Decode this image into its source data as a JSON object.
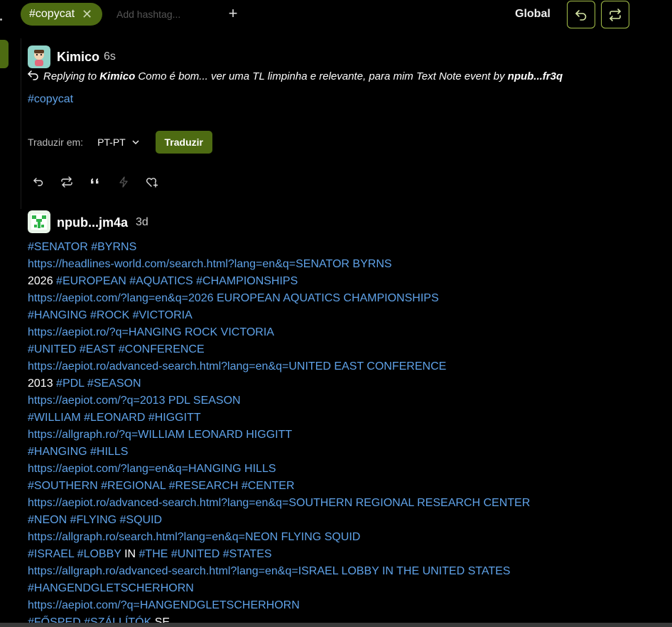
{
  "topbar": {
    "chip_label": "#copycat",
    "chip_close": "✕",
    "hashtag_placeholder": "Add hashtag...",
    "add_symbol": "+",
    "feed_label": "Global"
  },
  "note1": {
    "author": "Kimico",
    "time": "6s",
    "reply_prefix": "Replying to",
    "reply_author": "Kimico",
    "reply_text": "Como é bom... ver uma TL limpinha e relevante, para mim Text Note event by",
    "reply_npub": "npub...fr3q",
    "hashtag": "#copycat",
    "translate_label": "Traduzir em:",
    "lang": "PT-PT",
    "translate_button": "Traduzir"
  },
  "note2": {
    "author": "npub...jm4a",
    "time": "3d",
    "lines": [
      [
        {
          "t": "#SENATOR #BYRNS",
          "link": true
        }
      ],
      [
        {
          "t": "https://headlines-world.com/search.html?lang=en&q=SENATOR BYRNS",
          "link": true
        }
      ],
      [
        {
          "t": "2026 ",
          "link": false
        },
        {
          "t": "#EUROPEAN #AQUATICS #CHAMPIONSHIPS",
          "link": true
        }
      ],
      [
        {
          "t": "https://aepiot.com/?lang=en&q=2026 EUROPEAN AQUATICS CHAMPIONSHIPS",
          "link": true
        }
      ],
      [
        {
          "t": "#HANGING #ROCK #VICTORIA",
          "link": true
        }
      ],
      [
        {
          "t": "https://aepiot.ro/?q=HANGING ROCK VICTORIA",
          "link": true
        }
      ],
      [
        {
          "t": "#UNITED #EAST #CONFERENCE",
          "link": true
        }
      ],
      [
        {
          "t": "https://aepiot.ro/advanced-search.html?lang=en&q=UNITED EAST CONFERENCE",
          "link": true
        }
      ],
      [
        {
          "t": "2013 ",
          "link": false
        },
        {
          "t": "#PDL #SEASON",
          "link": true
        }
      ],
      [
        {
          "t": "https://aepiot.com/?q=2013 PDL SEASON",
          "link": true
        }
      ],
      [
        {
          "t": "#WILLIAM #LEONARD #HIGGITT",
          "link": true
        }
      ],
      [
        {
          "t": "https://allgraph.ro/?q=WILLIAM LEONARD HIGGITT",
          "link": true
        }
      ],
      [
        {
          "t": "#HANGING #HILLS",
          "link": true
        }
      ],
      [
        {
          "t": "https://aepiot.com/?lang=en&q=HANGING HILLS",
          "link": true
        }
      ],
      [
        {
          "t": "#SOUTHERN #REGIONAL #RESEARCH #CENTER",
          "link": true
        }
      ],
      [
        {
          "t": "https://aepiot.ro/advanced-search.html?lang=en&q=SOUTHERN REGIONAL RESEARCH CENTER",
          "link": true
        }
      ],
      [
        {
          "t": "#NEON #FLYING #SQUID",
          "link": true
        }
      ],
      [
        {
          "t": "https://allgraph.ro/search.html?lang=en&q=NEON FLYING SQUID",
          "link": true
        }
      ],
      [
        {
          "t": "#ISRAEL #LOBBY",
          "link": true
        },
        {
          "t": " IN ",
          "link": false
        },
        {
          "t": "#THE #UNITED #STATES",
          "link": true
        }
      ],
      [
        {
          "t": "https://allgraph.ro/advanced-search.html?lang=en&q=ISRAEL LOBBY IN THE UNITED STATES",
          "link": true
        }
      ],
      [
        {
          "t": "#HANGENDGLETSCHERHORN",
          "link": true
        }
      ],
      [
        {
          "t": "https://aepiot.com/?q=HANGENDGLETSCHERHORN",
          "link": true
        }
      ],
      [
        {
          "t": "#FŐSPED #SZÁLLÍTÓK",
          "link": true
        },
        {
          "t": " SE",
          "link": false
        }
      ]
    ]
  },
  "icons": {
    "reply": "reply-icon",
    "repost": "repost-icon",
    "quote": "quote-icon",
    "zap": "zap-icon",
    "react": "react-icon"
  },
  "colors": {
    "accent_green": "#4d6b12",
    "outline_green": "#a6c14a",
    "link_blue": "#5fa2e8"
  }
}
